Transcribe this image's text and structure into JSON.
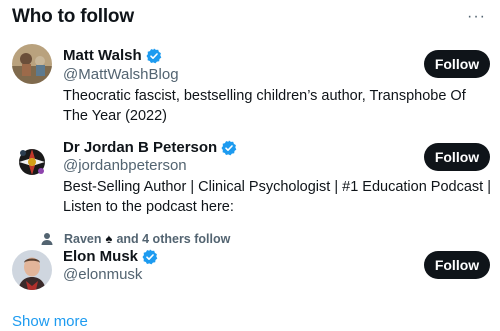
{
  "header": {
    "title": "Who to follow",
    "more_label": "···"
  },
  "users": [
    {
      "name": "Matt Walsh",
      "handle": "@MattWalshBlog",
      "bio": "Theocratic fascist, bestselling children’s author, Transphobe Of The Year (2022)",
      "follow_label": "Follow",
      "verified": true
    },
    {
      "name": "Dr Jordan B Peterson",
      "handle": "@jordanbpeterson",
      "bio": "Best-Selling Author | Clinical Psychologist | #1 Education Podcast | Listen to the podcast here:",
      "follow_label": "Follow",
      "verified": true
    },
    {
      "name": "Elon Musk",
      "handle": "@elonmusk",
      "bio": "",
      "follow_label": "Follow",
      "verified": true,
      "social_context": {
        "prefix": "Raven",
        "suffix": "and 4 others follow"
      }
    }
  ],
  "footer": {
    "show_more": "Show more"
  },
  "colors": {
    "accent": "#1d9bf0",
    "text": "#0f1419",
    "secondary": "#536471",
    "button_bg": "#0f1419"
  }
}
